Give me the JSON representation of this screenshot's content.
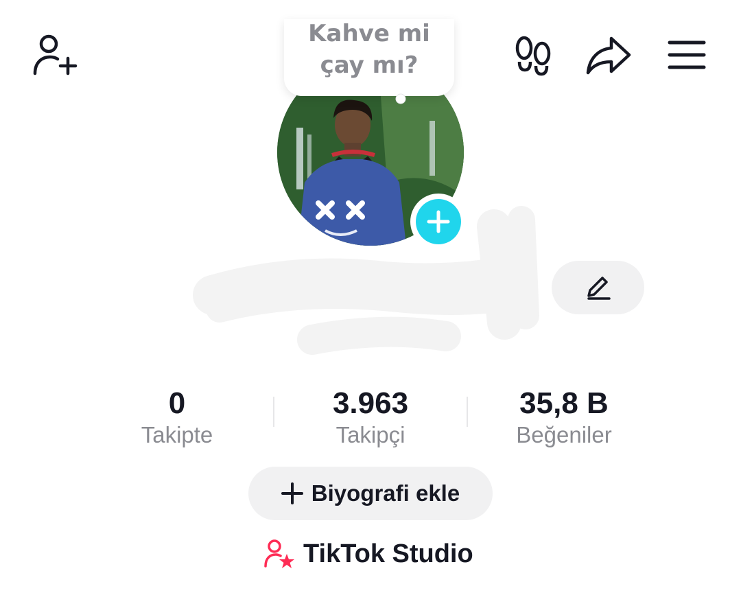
{
  "topbar": {
    "add_friend_icon": "person-plus-icon",
    "footprints_icon": "footprints-icon",
    "share_icon": "share-arrow-icon",
    "menu_icon": "hamburger-menu-icon"
  },
  "note": {
    "text_line1": "Kahve mi",
    "text_line2": "çay mı?"
  },
  "avatar": {
    "add_story_icon": "plus-icon",
    "accent_color": "#20d5ec"
  },
  "profile": {
    "edit_icon": "pencil-icon"
  },
  "stats": [
    {
      "value": "0",
      "label": "Takipte"
    },
    {
      "value": "3.963",
      "label": "Takipçi"
    },
    {
      "value": "35,8 B",
      "label": "Beğeniler"
    }
  ],
  "bio_button": {
    "icon": "plus-icon",
    "label": "Biyografi ekle"
  },
  "studio": {
    "icon": "person-star-icon",
    "label": "TikTok Studio",
    "icon_color": "#fe2c55"
  }
}
